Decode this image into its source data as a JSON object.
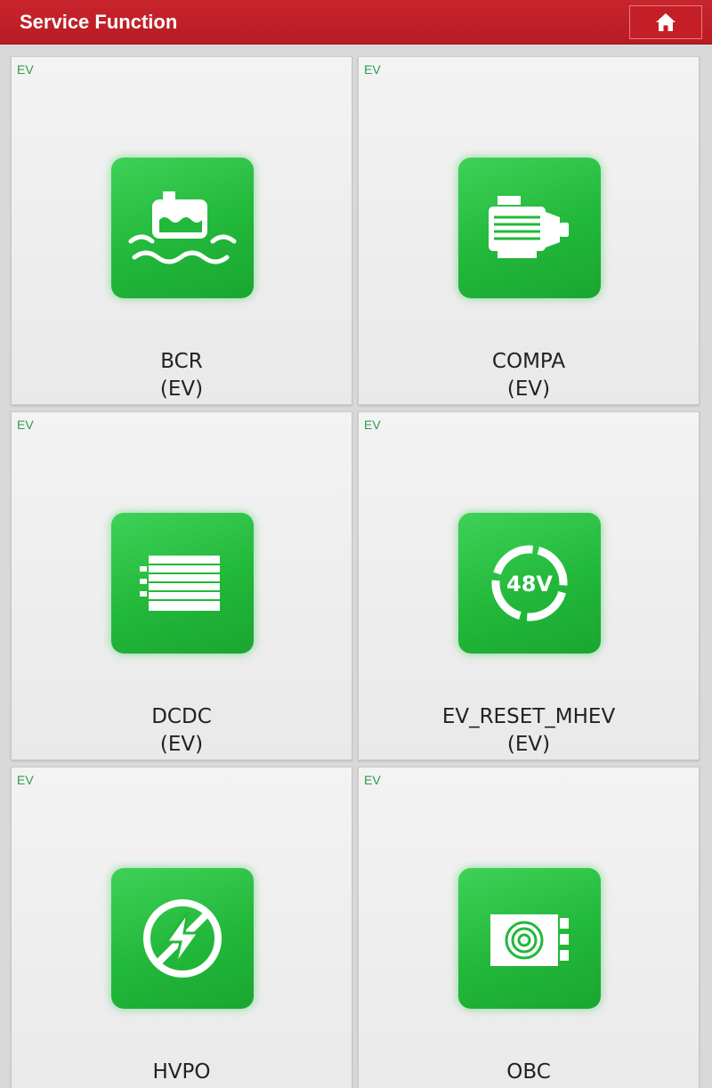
{
  "header": {
    "title": "Service Function",
    "home_icon": "home-icon"
  },
  "colors": {
    "header_red": "#c41f27",
    "tile_green": "#22b83a",
    "tag_green": "#2e9b4a"
  },
  "tiles": [
    {
      "tag": "EV",
      "name": "BCR",
      "sub": "(EV)",
      "icon": "coolant-tank-icon"
    },
    {
      "tag": "EV",
      "name": "COMPA",
      "sub": "(EV)",
      "icon": "compressor-motor-icon"
    },
    {
      "tag": "EV",
      "name": "DCDC",
      "sub": "(EV)",
      "icon": "dcdc-converter-icon"
    },
    {
      "tag": "EV",
      "name": "EV_RESET_MHEV",
      "sub": "(EV)",
      "icon": "48v-battery-icon"
    },
    {
      "tag": "EV",
      "name": "HVPO",
      "sub": "",
      "icon": "high-voltage-icon"
    },
    {
      "tag": "EV",
      "name": "OBC",
      "sub": "",
      "icon": "onboard-charger-icon"
    }
  ],
  "icon_text": {
    "battery_voltage": "48V"
  }
}
